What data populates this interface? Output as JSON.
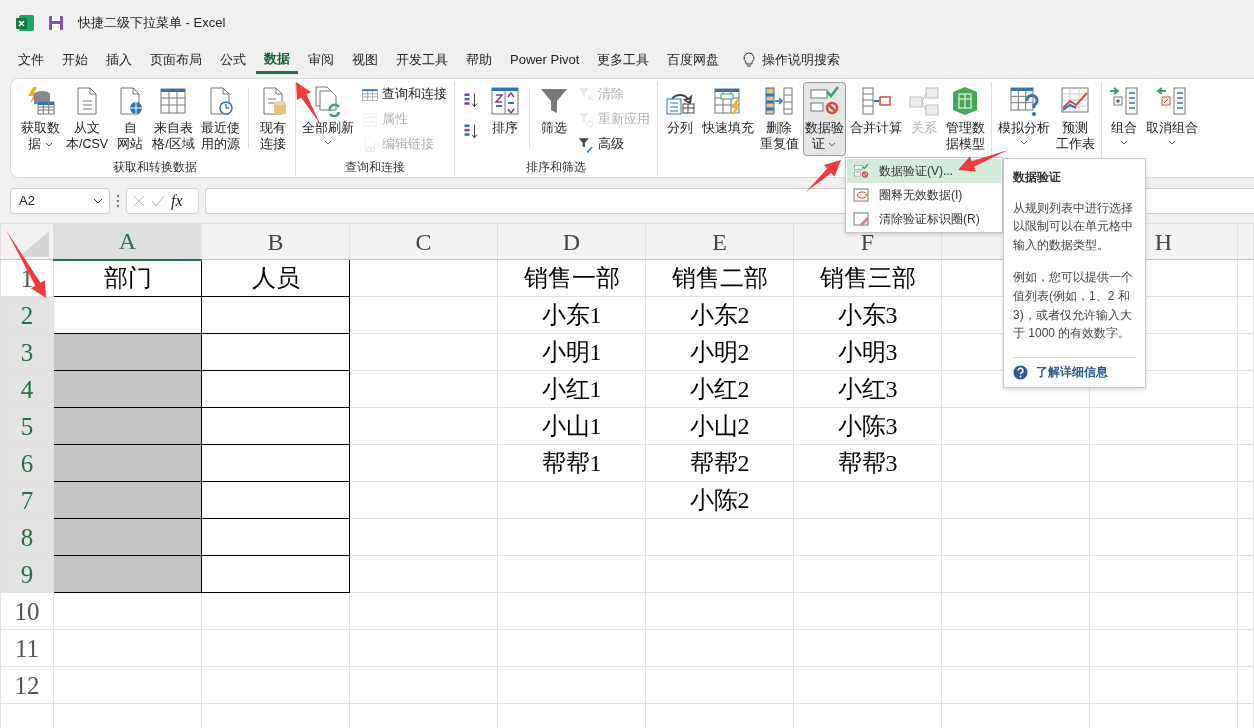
{
  "window": {
    "title": "快捷二级下拉菜单  -  Excel"
  },
  "tabs": [
    {
      "label": "文件",
      "selected": false
    },
    {
      "label": "开始",
      "selected": false
    },
    {
      "label": "插入",
      "selected": false
    },
    {
      "label": "页面布局",
      "selected": false
    },
    {
      "label": "公式",
      "selected": false
    },
    {
      "label": "数据",
      "selected": true
    },
    {
      "label": "审阅",
      "selected": false
    },
    {
      "label": "视图",
      "selected": false
    },
    {
      "label": "开发工具",
      "selected": false
    },
    {
      "label": "帮助",
      "selected": false
    },
    {
      "label": "Power Pivot",
      "selected": false
    },
    {
      "label": "更多工具",
      "selected": false
    },
    {
      "label": "百度网盘",
      "selected": false
    }
  ],
  "search": {
    "label": "操作说明搜索"
  },
  "ribbon": {
    "groups": [
      {
        "label": "获取和转换数据",
        "items": [
          {
            "kind": "large",
            "lines": [
              "获取数",
              "据"
            ],
            "dropdown": true,
            "disabled": false,
            "pressed": false
          },
          {
            "kind": "large",
            "lines": [
              "从文",
              "本/CSV"
            ],
            "disabled": false,
            "pressed": false
          },
          {
            "kind": "large",
            "lines": [
              "自",
              "网站"
            ],
            "disabled": false,
            "pressed": false
          },
          {
            "kind": "large",
            "lines": [
              "来自表",
              "格/区域"
            ],
            "disabled": false,
            "pressed": false
          },
          {
            "kind": "large",
            "lines": [
              "最近使",
              "用的源"
            ],
            "disabled": false,
            "pressed": false
          },
          {
            "kind": "separator"
          },
          {
            "kind": "large",
            "lines": [
              "现有",
              "连接"
            ],
            "disabled": false,
            "pressed": false
          }
        ]
      },
      {
        "label": "查询和连接",
        "items": [
          {
            "kind": "large",
            "lines": [
              "全部刷新"
            ],
            "dropdown": true,
            "disabled": false,
            "pressed": false
          },
          {
            "kind": "stack",
            "items": [
              {
                "label": "查询和连接",
                "disabled": false
              },
              {
                "label": "属性",
                "disabled": true
              },
              {
                "label": "编辑链接",
                "disabled": true
              }
            ]
          }
        ]
      },
      {
        "label": "排序和筛选",
        "items": [
          {
            "kind": "stack",
            "items": [
              {
                "disabled": false
              },
              {
                "disabled": false
              }
            ]
          },
          {
            "kind": "large",
            "lines": [
              "排序"
            ],
            "disabled": false,
            "pressed": false
          },
          {
            "kind": "separator"
          },
          {
            "kind": "large",
            "lines": [
              "筛选"
            ],
            "disabled": false,
            "pressed": false
          },
          {
            "kind": "stack",
            "items": [
              {
                "label": "清除",
                "disabled": true
              },
              {
                "label": "重新应用",
                "disabled": true
              },
              {
                "label": "高级",
                "disabled": false
              }
            ]
          }
        ]
      },
      {
        "items": [
          {
            "kind": "large",
            "lines": [
              "分列"
            ],
            "disabled": false,
            "pressed": false
          },
          {
            "kind": "large",
            "lines": [
              "快速填充"
            ],
            "disabled": false,
            "pressed": false
          },
          {
            "kind": "large",
            "lines": [
              "删除",
              "重复值"
            ],
            "disabled": false,
            "pressed": false
          },
          {
            "kind": "large",
            "lines": [
              "数据验",
              "证"
            ],
            "dropdown": true,
            "disabled": false,
            "pressed": true
          },
          {
            "kind": "large",
            "lines": [
              "合并计算"
            ],
            "disabled": false,
            "pressed": false
          },
          {
            "kind": "large",
            "lines": [
              "关系"
            ],
            "disabled": true,
            "pressed": false
          },
          {
            "kind": "large",
            "lines": [
              "管理数",
              "据模型"
            ],
            "disabled": false,
            "pressed": false
          }
        ]
      },
      {
        "items": [
          {
            "kind": "large",
            "lines": [
              "模拟分析"
            ],
            "dropdown": true,
            "disabled": false,
            "pressed": false
          },
          {
            "kind": "large",
            "lines": [
              "预测",
              "工作表"
            ],
            "disabled": false,
            "pressed": false
          }
        ]
      },
      {
        "items": [
          {
            "kind": "large",
            "lines": [
              "组合"
            ],
            "dropdown": true,
            "disabled": false,
            "pressed": false
          },
          {
            "kind": "large",
            "lines": [
              "取消组合"
            ],
            "dropdown": true,
            "disabled": false,
            "pressed": false
          }
        ]
      }
    ]
  },
  "formula_bar": {
    "name_box": "A2",
    "fx": "fx"
  },
  "sheet": {
    "columns": [
      {
        "label": "A",
        "selected": true
      },
      {
        "label": "B",
        "selected": false
      },
      {
        "label": "C",
        "selected": false
      },
      {
        "label": "D",
        "selected": false
      },
      {
        "label": "E",
        "selected": false
      },
      {
        "label": "F",
        "selected": false
      },
      {
        "selected": false
      },
      {
        "label": "H",
        "selected": false
      }
    ],
    "rows": [
      {
        "label": "1",
        "selected": false,
        "cells": [
          {
            "text": "部门",
            "bordered": true
          },
          {
            "text": "人员",
            "bordered": true
          },
          null,
          "销售一部",
          "销售二部",
          "销售三部",
          null,
          null
        ]
      },
      {
        "label": "2",
        "selected": true,
        "cells": [
          {
            "bordered": true,
            "active": true
          },
          {
            "bordered": true
          },
          null,
          "小东1",
          "小东2",
          "小东3",
          null,
          null
        ]
      },
      {
        "label": "3",
        "selected": true,
        "cells": [
          {
            "bordered": true,
            "active": false
          },
          {
            "bordered": true
          },
          null,
          "小明1",
          "小明2",
          "小明3",
          null,
          null
        ]
      },
      {
        "label": "4",
        "selected": true,
        "cells": [
          {
            "bordered": true,
            "active": false
          },
          {
            "bordered": true
          },
          null,
          "小红1",
          "小红2",
          "小红3",
          null,
          null
        ]
      },
      {
        "label": "5",
        "selected": true,
        "cells": [
          {
            "bordered": true,
            "active": false
          },
          {
            "bordered": true
          },
          null,
          "小山1",
          "小山2",
          "小陈3",
          null,
          null
        ]
      },
      {
        "label": "6",
        "selected": true,
        "cells": [
          {
            "bordered": true,
            "active": false
          },
          {
            "bordered": true
          },
          null,
          "帮帮1",
          "帮帮2",
          "帮帮3",
          null,
          null
        ]
      },
      {
        "label": "7",
        "selected": true,
        "cells": [
          {
            "bordered": true,
            "active": false
          },
          {
            "bordered": true
          },
          null,
          null,
          "小陈2",
          null,
          null,
          null
        ]
      },
      {
        "label": "8",
        "selected": true,
        "cells": [
          {
            "bordered": true,
            "active": false
          },
          {
            "bordered": true
          },
          null,
          null,
          null,
          null,
          null,
          null
        ]
      },
      {
        "label": "9",
        "selected": true,
        "cells": [
          {
            "bordered": true,
            "active": false
          },
          {
            "bordered": true
          },
          null,
          null,
          null,
          null,
          null,
          null
        ]
      },
      {
        "label": "10",
        "selected": false
      },
      {
        "label": "11",
        "selected": false
      },
      {
        "label": "12",
        "selected": false
      },
      {
        "selected": false
      }
    ]
  },
  "dropdown": {
    "items": [
      {
        "label": "数据验证(V)...",
        "selected": true
      },
      {
        "label": "圈释无效数据(I)",
        "selected": false
      },
      {
        "label": "清除验证标识圈(R)",
        "selected": false
      }
    ]
  },
  "tooltip": {
    "title": "数据验证",
    "paragraphs": [
      "从规则列表中进行选择以限制可以在单元格中输入的数据类型。",
      "例如，您可以提供一个值列表(例如，1、2 和 3)，或者仅允许输入大于 1000 的有效数字。"
    ],
    "link": "了解详细信息"
  }
}
